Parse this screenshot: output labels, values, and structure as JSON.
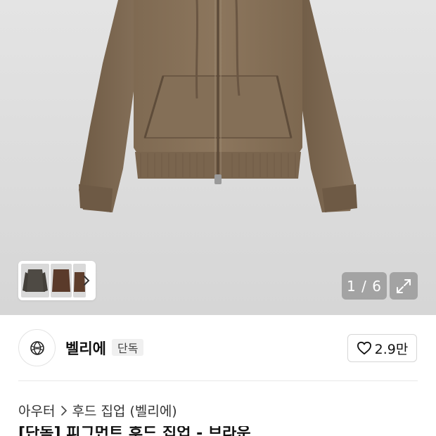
{
  "gallery": {
    "counter": "1 / 6",
    "colors": {
      "hoodie": "#8a735a",
      "hoodie_dark": "#6e5a45",
      "rib": "#7d6750"
    }
  },
  "brand": {
    "name": "벨리에",
    "badge": "단독",
    "like_count": "2.9만"
  },
  "breadcrumb": {
    "category": "아우터",
    "subcategory": "후드 집업 (벨리에)"
  },
  "product": {
    "title_partial": "[단독] 피그먼트 후드 집업 - 브라운"
  }
}
